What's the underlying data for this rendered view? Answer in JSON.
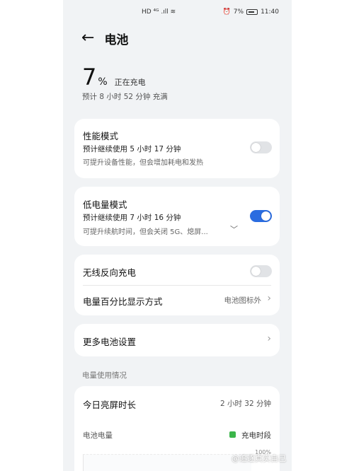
{
  "status_bar": {
    "left_icons": "HD ⁴ᴳ .ıll ≋",
    "battery_percent": "7%",
    "time": "11:40"
  },
  "header": {
    "title": "电池"
  },
  "battery": {
    "level": "7",
    "unit": "%",
    "status": "正在充电",
    "estimate": "预计 8 小时 52 分钟 充满"
  },
  "performance_mode": {
    "title": "性能模式",
    "subtitle": "预计继续使用 5 小时 17 分钟",
    "desc": "可提升设备性能，但会增加耗电和发热",
    "enabled": false
  },
  "low_power_mode": {
    "title": "低电量模式",
    "subtitle": "预计继续使用 7 小时 16 分钟",
    "desc": "可提升续航时间，但会关闭 5G、熄屏...",
    "enabled": true
  },
  "wireless_reverse": {
    "title": "无线反向充电",
    "enabled": false
  },
  "percentage_display": {
    "title": "电量百分比显示方式",
    "value": "电池图标外"
  },
  "more_settings": {
    "title": "更多电池设置"
  },
  "usage": {
    "section_label": "电量使用情况",
    "screen_time_label": "今日亮屏时长",
    "screen_time_value": "2 小时 32 分钟",
    "battery_level_label": "电池电量",
    "legend_label": "充电时段",
    "legend_color": "#3bb54a",
    "y_max_label": "100%"
  },
  "watermark": "@追逐真实自己",
  "icons": {
    "back": "arrow-left-icon",
    "chevron": "chevron-right-icon",
    "expand": "chevron-down-icon",
    "alarm": "alarm-icon"
  }
}
